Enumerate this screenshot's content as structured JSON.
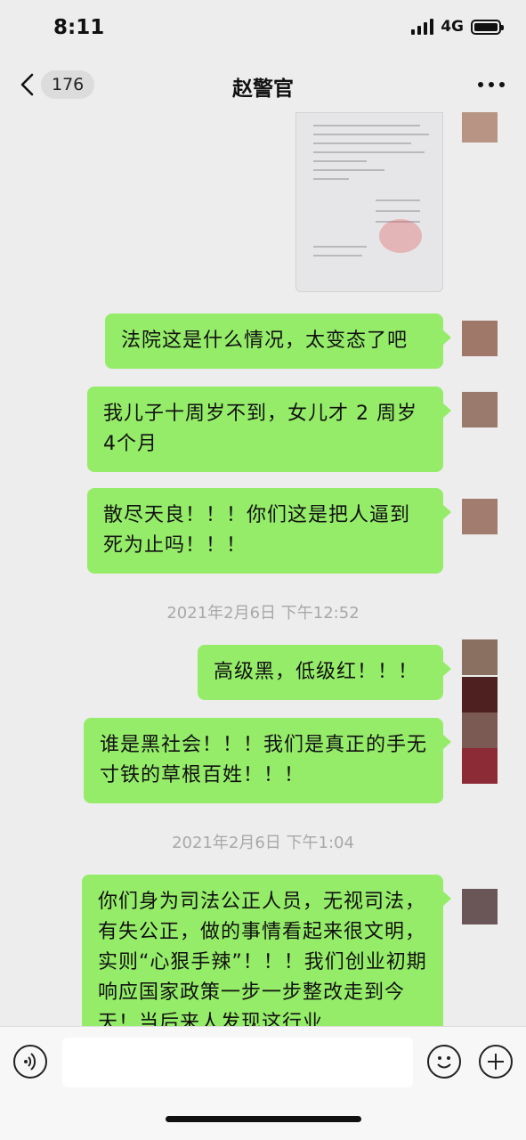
{
  "status_bar": {
    "time": "8:11",
    "network": "4G"
  },
  "nav": {
    "unread_count": "176",
    "title": "赵警官"
  },
  "messages": [
    {
      "text": "法院这是什么情况，太变态了吧"
    },
    {
      "text": "我儿子十周岁不到，女儿才 2 周岁 4个月"
    },
    {
      "text": "散尽天良！！！你们这是把人逼到死为止吗！！！"
    },
    {
      "text": "高级黑，低级红！！！"
    },
    {
      "text": "谁是黑社会！！！我们是真正的手无寸铁的草根百姓！！！"
    },
    {
      "text": "你们身为司法公正人员，无视司法，有失公正，做的事情看起来很文明，实则“心狠手辣”！！！我们创业初期响应国家政策一步一步整改走到今天！当后来人发现这行业"
    }
  ],
  "timestamps": [
    "2021年2月6日 下午12:52",
    "2021年2月6日 下午1:04"
  ],
  "input": {
    "value": ""
  },
  "icons": {
    "back": "chevron-left-icon",
    "more": "more-dots-icon",
    "voice": "voice-icon",
    "emoji": "emoji-icon",
    "plus": "plus-icon"
  },
  "colors": {
    "bubble": "#95ec69",
    "background": "#ededed"
  }
}
